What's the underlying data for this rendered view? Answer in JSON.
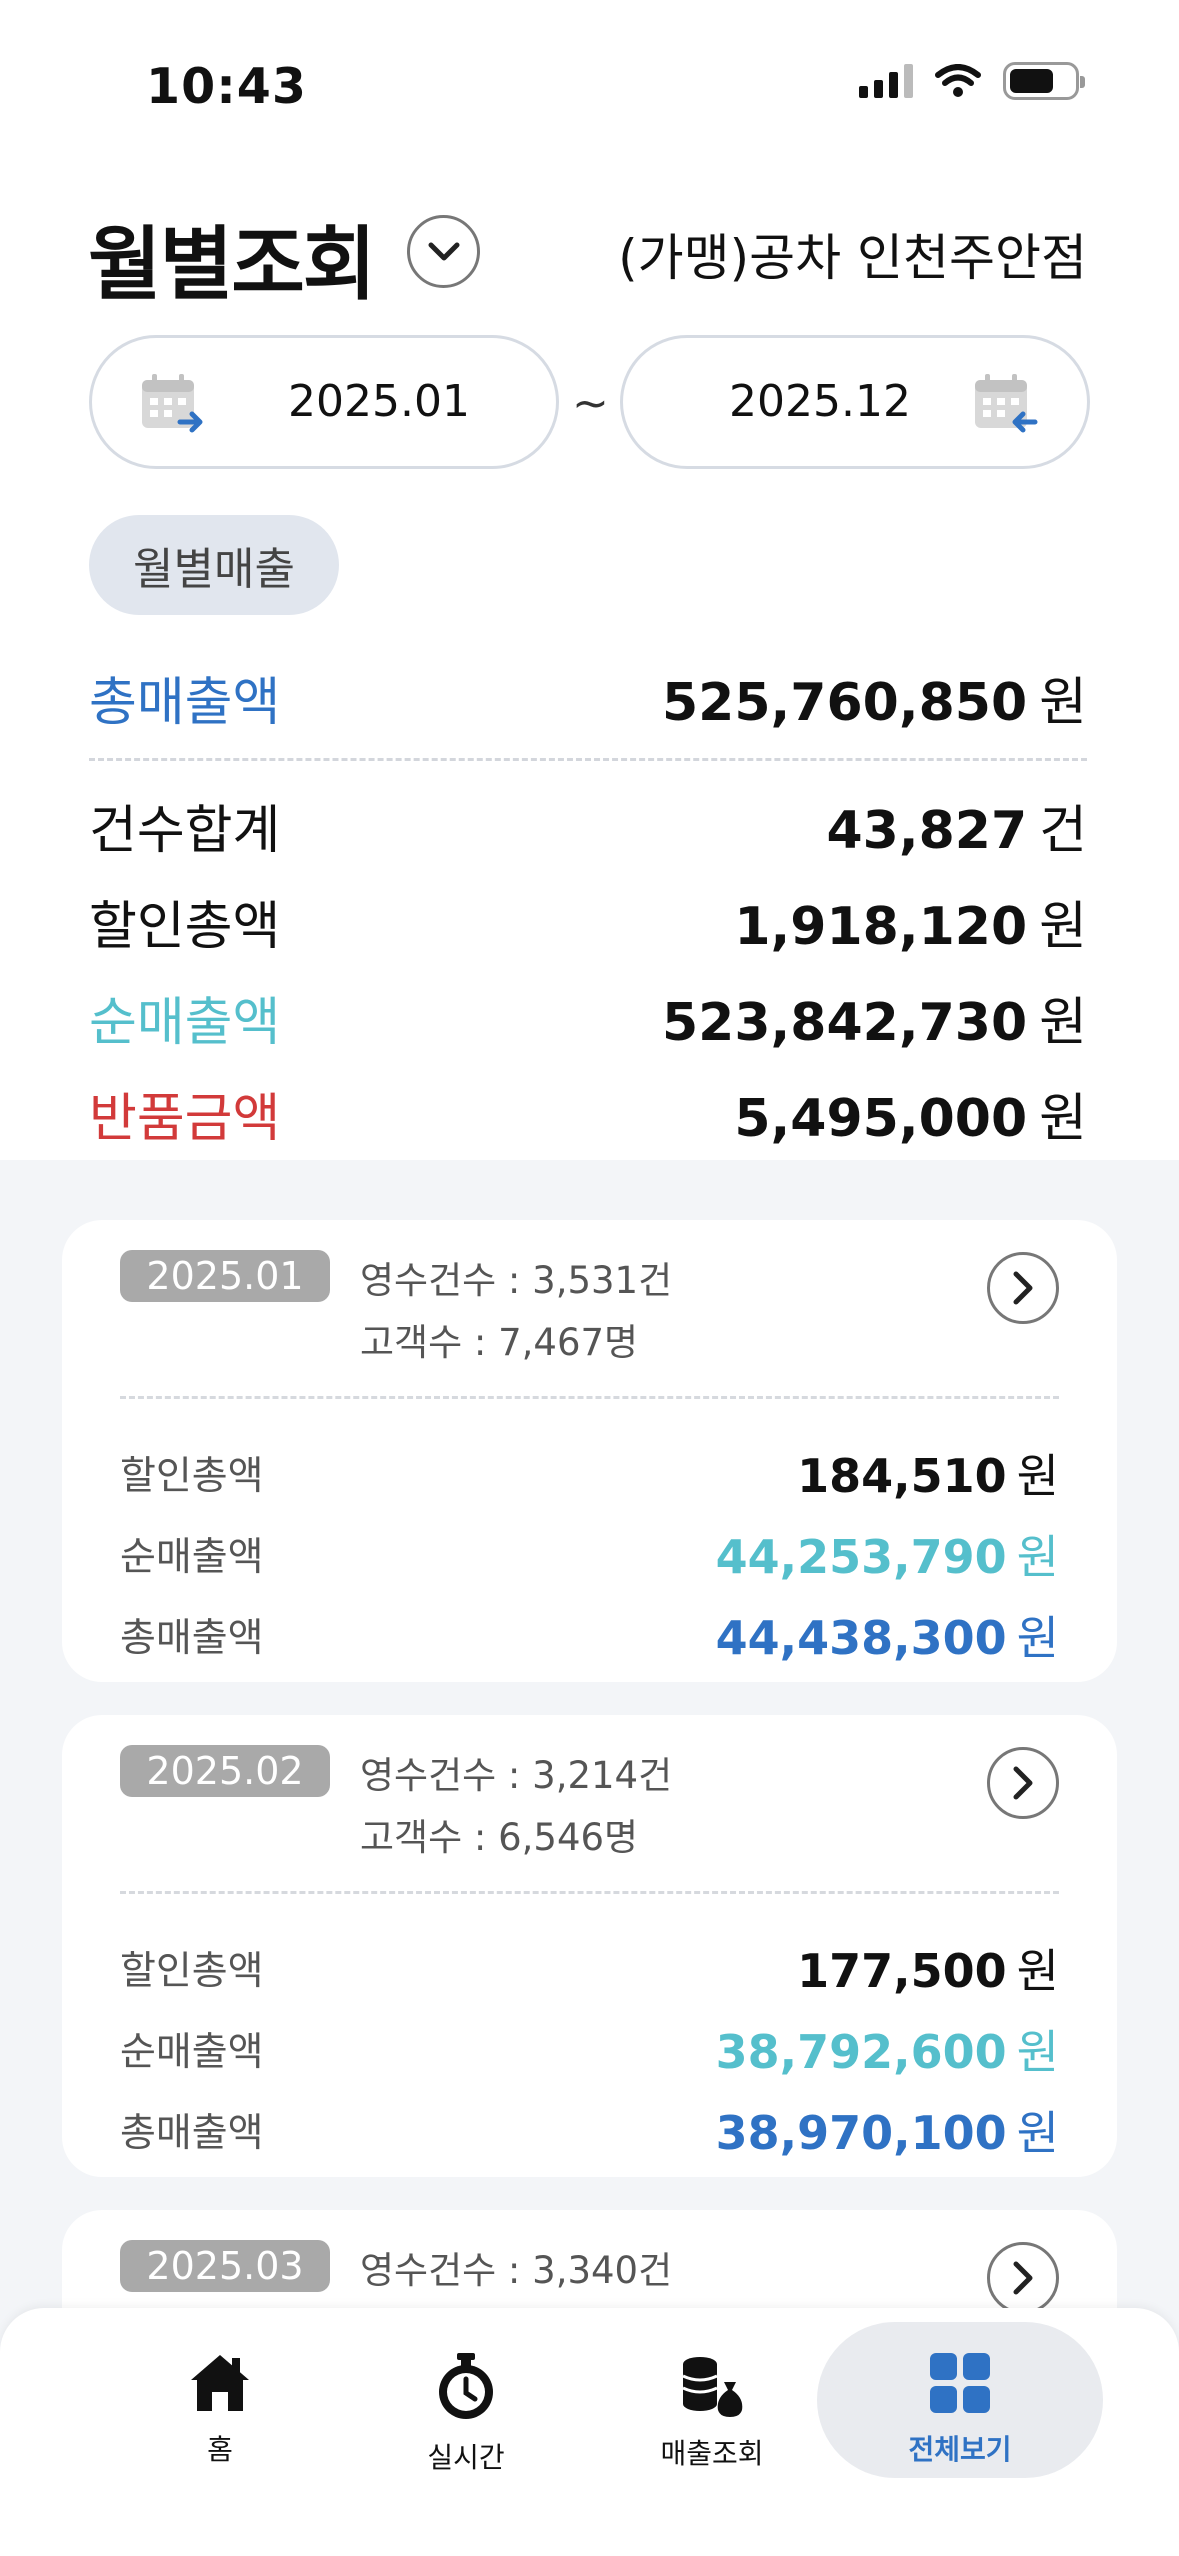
{
  "status_bar": {
    "time": "10:43"
  },
  "header": {
    "title": "월별조회",
    "store_name": "(가맹)공차 인천주안점"
  },
  "date_range": {
    "start": "2025.01",
    "separator": "~",
    "end": "2025.12"
  },
  "chip": {
    "label": "월별매출"
  },
  "summary": {
    "total_sales": {
      "label": "총매출액",
      "value": "525,760,850",
      "unit": "원"
    },
    "count_total": {
      "label": "건수합계",
      "value": "43,827",
      "unit": "건"
    },
    "discount_total": {
      "label": "할인총액",
      "value": "1,918,120",
      "unit": "원"
    },
    "net_sales": {
      "label": "순매출액",
      "value": "523,842,730",
      "unit": "원"
    },
    "return_amount": {
      "label": "반품금액",
      "value": "5,495,000",
      "unit": "원"
    }
  },
  "months": [
    {
      "month": "2025.01",
      "receipts": "영수건수 : 3,531건",
      "customers": "고객수 : 7,467명",
      "discount_label": "할인총액",
      "discount": "184,510",
      "discount_unit": "원",
      "net_label": "순매출액",
      "net": "44,253,790",
      "net_unit": "원",
      "total_label": "총매출액",
      "total": "44,438,300",
      "total_unit": "원"
    },
    {
      "month": "2025.02",
      "receipts": "영수건수 : 3,214건",
      "customers": "고객수 : 6,546명",
      "discount_label": "할인총액",
      "discount": "177,500",
      "discount_unit": "원",
      "net_label": "순매출액",
      "net": "38,792,600",
      "net_unit": "원",
      "total_label": "총매출액",
      "total": "38,970,100",
      "total_unit": "원"
    },
    {
      "month": "2025.03",
      "receipts": "영수건수 : 3,340건"
    }
  ],
  "bottom_nav": {
    "home": "홈",
    "realtime": "실시간",
    "sales": "매출조회",
    "all": "전체보기"
  },
  "colors": {
    "blue": "#2f72c4",
    "cyan": "#55bfcc",
    "red": "#d23a3a",
    "active_nav_bg": "#e9ebef"
  }
}
